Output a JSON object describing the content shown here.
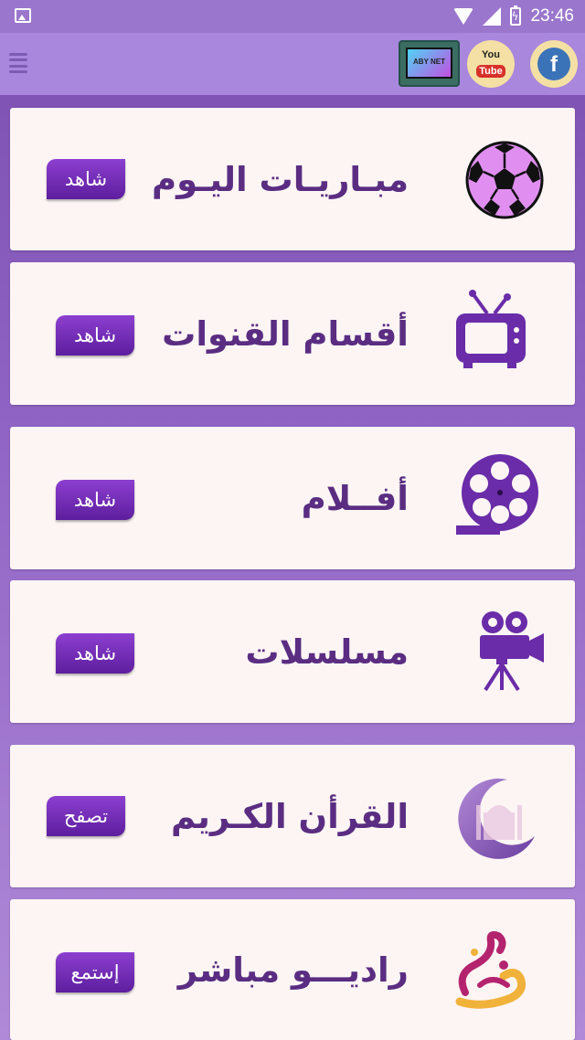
{
  "status_bar": {
    "time": "23:46"
  },
  "app_bar": {
    "tv_logo_text": "ABY NET",
    "youtube": {
      "line1": "You",
      "line2": "Tube"
    },
    "facebook": "f"
  },
  "menu": [
    {
      "title": "مبـاريـات اليـوم",
      "button": "شاهد"
    },
    {
      "title": "أقسام القنوات",
      "button": "شاهد"
    },
    {
      "title": "أفــلام",
      "button": "شاهد"
    },
    {
      "title": "مسلسلات",
      "button": "شاهد"
    },
    {
      "title": "القرأن الكـريم",
      "button": "تصفح"
    },
    {
      "title": "راديـــو مباشر",
      "button": "إستمع"
    }
  ]
}
